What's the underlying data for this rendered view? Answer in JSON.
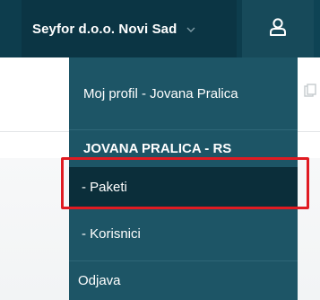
{
  "topbar": {
    "company_label": "Seyfor d.o.o. Novi Sad",
    "company_chevron_icon": "chevron-down-icon",
    "user_icon": "user-icon"
  },
  "menu": {
    "items": [
      {
        "label": "Moj profil - Jovana Pralica"
      },
      {
        "label": "JOVANA PRALICA - RS"
      },
      {
        "label": "- Paketi"
      },
      {
        "label": "- Korisnici"
      },
      {
        "label": "Odjava"
      }
    ],
    "selected_index": 2
  },
  "highlight": {
    "color": "#e01b22"
  },
  "colors": {
    "topbar": "#0d3d4d",
    "menu_bg": "#1d5566",
    "menu_selected_bg": "#0b2e3a"
  }
}
